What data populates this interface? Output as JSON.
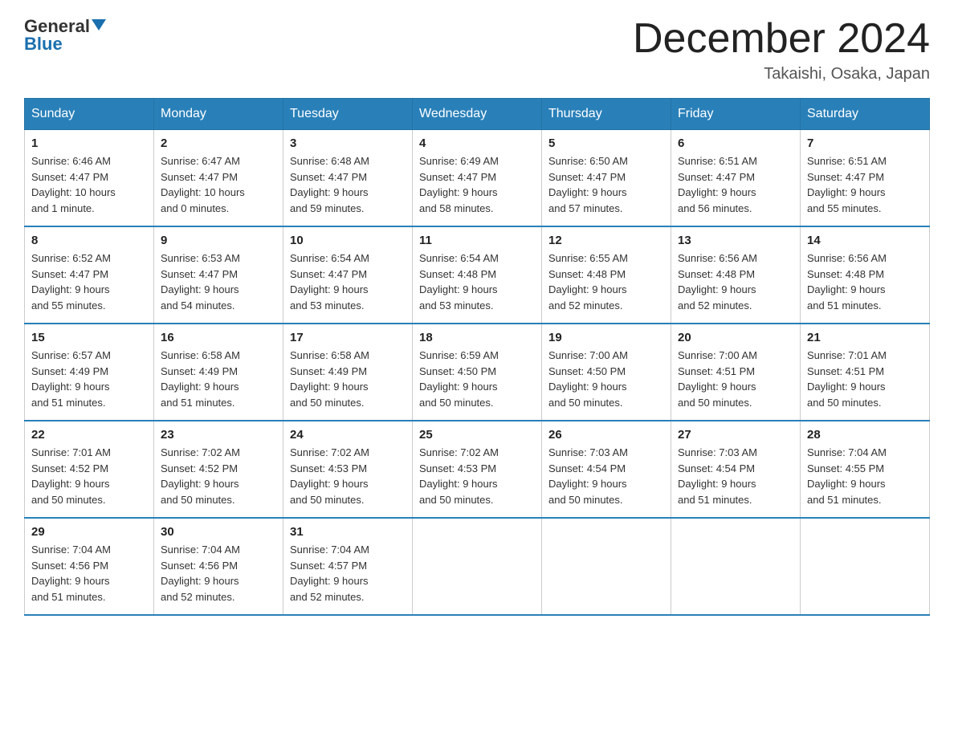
{
  "header": {
    "logo_general": "General",
    "logo_blue": "Blue",
    "month_title": "December 2024",
    "location": "Takaishi, Osaka, Japan"
  },
  "days_of_week": [
    "Sunday",
    "Monday",
    "Tuesday",
    "Wednesday",
    "Thursday",
    "Friday",
    "Saturday"
  ],
  "weeks": [
    [
      {
        "day": "1",
        "info": "Sunrise: 6:46 AM\nSunset: 4:47 PM\nDaylight: 10 hours\nand 1 minute."
      },
      {
        "day": "2",
        "info": "Sunrise: 6:47 AM\nSunset: 4:47 PM\nDaylight: 10 hours\nand 0 minutes."
      },
      {
        "day": "3",
        "info": "Sunrise: 6:48 AM\nSunset: 4:47 PM\nDaylight: 9 hours\nand 59 minutes."
      },
      {
        "day": "4",
        "info": "Sunrise: 6:49 AM\nSunset: 4:47 PM\nDaylight: 9 hours\nand 58 minutes."
      },
      {
        "day": "5",
        "info": "Sunrise: 6:50 AM\nSunset: 4:47 PM\nDaylight: 9 hours\nand 57 minutes."
      },
      {
        "day": "6",
        "info": "Sunrise: 6:51 AM\nSunset: 4:47 PM\nDaylight: 9 hours\nand 56 minutes."
      },
      {
        "day": "7",
        "info": "Sunrise: 6:51 AM\nSunset: 4:47 PM\nDaylight: 9 hours\nand 55 minutes."
      }
    ],
    [
      {
        "day": "8",
        "info": "Sunrise: 6:52 AM\nSunset: 4:47 PM\nDaylight: 9 hours\nand 55 minutes."
      },
      {
        "day": "9",
        "info": "Sunrise: 6:53 AM\nSunset: 4:47 PM\nDaylight: 9 hours\nand 54 minutes."
      },
      {
        "day": "10",
        "info": "Sunrise: 6:54 AM\nSunset: 4:47 PM\nDaylight: 9 hours\nand 53 minutes."
      },
      {
        "day": "11",
        "info": "Sunrise: 6:54 AM\nSunset: 4:48 PM\nDaylight: 9 hours\nand 53 minutes."
      },
      {
        "day": "12",
        "info": "Sunrise: 6:55 AM\nSunset: 4:48 PM\nDaylight: 9 hours\nand 52 minutes."
      },
      {
        "day": "13",
        "info": "Sunrise: 6:56 AM\nSunset: 4:48 PM\nDaylight: 9 hours\nand 52 minutes."
      },
      {
        "day": "14",
        "info": "Sunrise: 6:56 AM\nSunset: 4:48 PM\nDaylight: 9 hours\nand 51 minutes."
      }
    ],
    [
      {
        "day": "15",
        "info": "Sunrise: 6:57 AM\nSunset: 4:49 PM\nDaylight: 9 hours\nand 51 minutes."
      },
      {
        "day": "16",
        "info": "Sunrise: 6:58 AM\nSunset: 4:49 PM\nDaylight: 9 hours\nand 51 minutes."
      },
      {
        "day": "17",
        "info": "Sunrise: 6:58 AM\nSunset: 4:49 PM\nDaylight: 9 hours\nand 50 minutes."
      },
      {
        "day": "18",
        "info": "Sunrise: 6:59 AM\nSunset: 4:50 PM\nDaylight: 9 hours\nand 50 minutes."
      },
      {
        "day": "19",
        "info": "Sunrise: 7:00 AM\nSunset: 4:50 PM\nDaylight: 9 hours\nand 50 minutes."
      },
      {
        "day": "20",
        "info": "Sunrise: 7:00 AM\nSunset: 4:51 PM\nDaylight: 9 hours\nand 50 minutes."
      },
      {
        "day": "21",
        "info": "Sunrise: 7:01 AM\nSunset: 4:51 PM\nDaylight: 9 hours\nand 50 minutes."
      }
    ],
    [
      {
        "day": "22",
        "info": "Sunrise: 7:01 AM\nSunset: 4:52 PM\nDaylight: 9 hours\nand 50 minutes."
      },
      {
        "day": "23",
        "info": "Sunrise: 7:02 AM\nSunset: 4:52 PM\nDaylight: 9 hours\nand 50 minutes."
      },
      {
        "day": "24",
        "info": "Sunrise: 7:02 AM\nSunset: 4:53 PM\nDaylight: 9 hours\nand 50 minutes."
      },
      {
        "day": "25",
        "info": "Sunrise: 7:02 AM\nSunset: 4:53 PM\nDaylight: 9 hours\nand 50 minutes."
      },
      {
        "day": "26",
        "info": "Sunrise: 7:03 AM\nSunset: 4:54 PM\nDaylight: 9 hours\nand 50 minutes."
      },
      {
        "day": "27",
        "info": "Sunrise: 7:03 AM\nSunset: 4:54 PM\nDaylight: 9 hours\nand 51 minutes."
      },
      {
        "day": "28",
        "info": "Sunrise: 7:04 AM\nSunset: 4:55 PM\nDaylight: 9 hours\nand 51 minutes."
      }
    ],
    [
      {
        "day": "29",
        "info": "Sunrise: 7:04 AM\nSunset: 4:56 PM\nDaylight: 9 hours\nand 51 minutes."
      },
      {
        "day": "30",
        "info": "Sunrise: 7:04 AM\nSunset: 4:56 PM\nDaylight: 9 hours\nand 52 minutes."
      },
      {
        "day": "31",
        "info": "Sunrise: 7:04 AM\nSunset: 4:57 PM\nDaylight: 9 hours\nand 52 minutes."
      },
      {
        "day": "",
        "info": ""
      },
      {
        "day": "",
        "info": ""
      },
      {
        "day": "",
        "info": ""
      },
      {
        "day": "",
        "info": ""
      }
    ]
  ]
}
